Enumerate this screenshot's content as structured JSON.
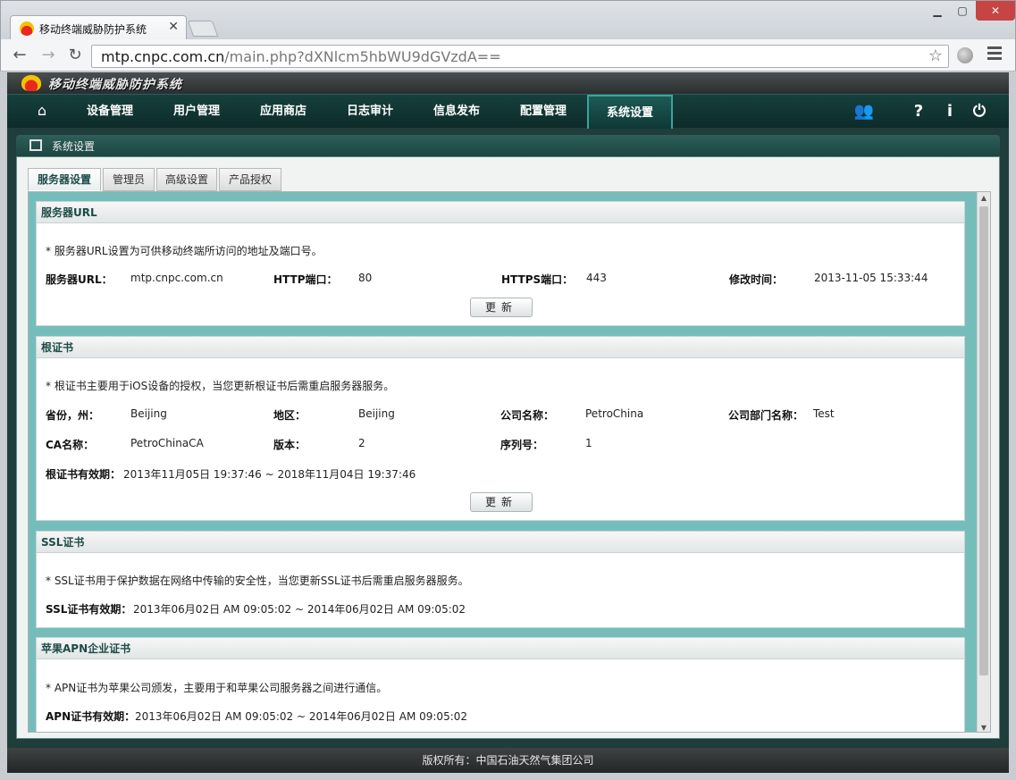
{
  "browser": {
    "tab_title": "移动终端威胁防护系统",
    "address_host": "mtp.cnpc.com.cn",
    "address_path": "/main.php?dXNlcm5hbWU9dGVzdA=="
  },
  "app": {
    "banner_title": "移动终端威胁防护系统",
    "nav": [
      "设备管理",
      "用户管理",
      "应用商店",
      "日志审计",
      "信息发布",
      "配置管理",
      "系统设置"
    ],
    "nav_active": "系统设置",
    "crumb": "系统设置",
    "subtabs": [
      "服务器设置",
      "管理员",
      "高级设置",
      "产品授权"
    ],
    "subtab_active": "服务器设置",
    "footer": "版权所有：中国石油天然气集团公司"
  },
  "server_url": {
    "title": "服务器URL",
    "note": "* 服务器URL设置为可供移动终端所访问的地址及端口号。",
    "url_label": "服务器URL：",
    "url_value": "mtp.cnpc.com.cn",
    "http_label": "HTTP端口：",
    "http_value": "80",
    "https_label": "HTTPS端口：",
    "https_value": "443",
    "mtime_label": "修改时间：",
    "mtime_value": "2013-11-05 15:33:44",
    "update_btn": "更新"
  },
  "root_cert": {
    "title": "根证书",
    "note": "* 根证书主要用于iOS设备的授权，当您更新根证书后需重启服务器服务。",
    "province_label": "省份，州：",
    "province_value": "Beijing",
    "region_label": "地区：",
    "region_value": "Beijing",
    "company_label": "公司名称：",
    "company_value": "PetroChina",
    "dept_label": "公司部门名称：",
    "dept_value": "Test",
    "ca_label": "CA名称：",
    "ca_value": "PetroChinaCA",
    "version_label": "版本：",
    "version_value": "2",
    "serial_label": "序列号：",
    "serial_value": "1",
    "validity_label": "根证书有效期：",
    "validity_value": "2013年11月05日 19:37:46 ~ 2018年11月04日 19:37:46",
    "update_btn": "更新"
  },
  "ssl_cert": {
    "title": "SSL证书",
    "note": "* SSL证书用于保护数据在网络中传输的安全性，当您更新SSL证书后需重启服务器服务。",
    "validity_label": "SSL证书有效期：",
    "validity_value": "2013年06月02日 AM 09:05:02 ~ 2014年06月02日 AM 09:05:02"
  },
  "apn_cert": {
    "title": "苹果APN企业证书",
    "note": "* APN证书为苹果公司颁发，主要用于和苹果公司服务器之间进行通信。",
    "validity_label": "APN证书有效期：",
    "validity_value": "2013年06月02日 AM 09:05:02 ~ 2014年06月02日 AM 09:05:02"
  }
}
